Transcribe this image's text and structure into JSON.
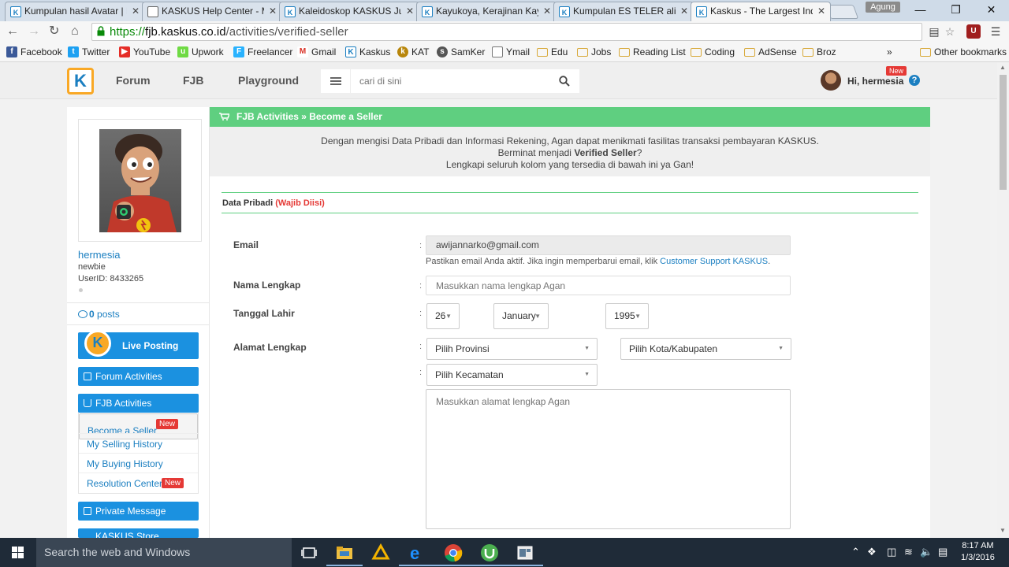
{
  "browser": {
    "tabs": [
      {
        "title": "Kumpulan hasil Avatar | K",
        "favicon": "kaskus-icon"
      },
      {
        "title": "KASKUS Help Center - M",
        "favicon": "document-icon"
      },
      {
        "title": "Kaleidoskop KASKUS Jua",
        "favicon": "kaskus-icon"
      },
      {
        "title": "Kayukoya, Kerajinan Kayu",
        "favicon": "kaskus-icon"
      },
      {
        "title": "Kumpulan ES TELER alias",
        "favicon": "kaskus-icon"
      },
      {
        "title": "Kaskus - The Largest Ind",
        "favicon": "kaskus-icon",
        "active": true
      }
    ],
    "profile_name": "Agung",
    "url_scheme": "https://",
    "url_host": "fjb.kaskus.co.id",
    "url_path": "/activities/verified-seller",
    "bookmarks": [
      {
        "label": "Facebook",
        "icon": "facebook-icon",
        "color": "#3b5998"
      },
      {
        "label": "Twitter",
        "icon": "twitter-icon",
        "color": "#1da1f2"
      },
      {
        "label": "YouTube",
        "icon": "youtube-icon",
        "color": "#e52d27"
      },
      {
        "label": "Upwork",
        "icon": "upwork-icon",
        "color": "#6fda44"
      },
      {
        "label": "Freelancer",
        "icon": "freelancer-icon",
        "color": "#29b2fe"
      },
      {
        "label": "Gmail",
        "icon": "gmail-icon",
        "color": "#d93025"
      },
      {
        "label": "Kaskus",
        "icon": "kaskus-icon",
        "color": "#1b7fc1"
      },
      {
        "label": "KAT",
        "icon": "kat-icon",
        "color": "#b8860b"
      },
      {
        "label": "SamKer",
        "icon": "samker-icon",
        "color": "#555555"
      },
      {
        "label": "Ymail",
        "icon": "document-icon",
        "color": "#888888"
      },
      {
        "label": "Edu",
        "icon": "folder-icon",
        "color": "#d8a93a"
      },
      {
        "label": "Jobs",
        "icon": "folder-icon",
        "color": "#d8a93a"
      },
      {
        "label": "Reading List",
        "icon": "folder-icon",
        "color": "#d8a93a"
      },
      {
        "label": "Coding",
        "icon": "folder-icon",
        "color": "#d8a93a"
      },
      {
        "label": "AdSense",
        "icon": "folder-icon",
        "color": "#d8a93a"
      },
      {
        "label": "Broz",
        "icon": "folder-icon",
        "color": "#d8a93a"
      }
    ],
    "more_bookmarks": "»",
    "other_bookmarks": "Other bookmarks"
  },
  "site": {
    "logo_letter": "K",
    "nav": [
      "Forum",
      "FJB",
      "Playground"
    ],
    "search_placeholder": "cari di sini",
    "greeting": "Hi, hermesia",
    "new_badge": "New",
    "help": "?"
  },
  "sidebar": {
    "username": "hermesia",
    "rank": "newbie",
    "user_id": "UserID: 8433265",
    "posts_count": "0",
    "posts_label": " posts",
    "live_posting": "Live Posting",
    "forum_activities": "Forum Activities",
    "fjb_activities": "FJB Activities",
    "fjb_items": [
      {
        "label": "Become a Seller",
        "badge": "New"
      },
      {
        "label": "My Selling History",
        "badge": ""
      },
      {
        "label": "My Buying History",
        "badge": ""
      },
      {
        "label": "Resolution Center",
        "badge": "New"
      }
    ],
    "private_message": "Private Message",
    "kaskus_store": "KASKUS Store"
  },
  "main": {
    "breadcrumb": "FJB Activities » Become a Seller",
    "intro_line1": "Dengan mengisi Data Pribadi dan Informasi Rekening, Agan dapat menikmati fasilitas transaksi pembayaran KASKUS.",
    "intro_line2_pre": "Berminat menjadi ",
    "intro_line2_bold": "Verified Seller",
    "intro_line2_post": "?",
    "intro_line3": "Lengkapi seluruh kolom yang tersedia di bawah ini ya Gan!",
    "section_title": "Data Pribadi ",
    "section_required": "(Wajib Diisi)",
    "email_label": "Email",
    "email_value": "awijannarko@gmail.com",
    "email_hint_pre": "Pastikan email Anda aktif. Jika ingin memperbarui email, klik ",
    "email_hint_link": "Customer Support KASKUS",
    "email_hint_post": ".",
    "name_label": "Nama Lengkap",
    "name_placeholder": "Masukkan nama lengkap Agan",
    "dob_label": "Tanggal Lahir",
    "dob_day": "26",
    "dob_month": "January",
    "dob_year": "1995",
    "address_label": "Alamat Lengkap",
    "province_placeholder": "Pilih Provinsi",
    "city_placeholder": "Pilih Kota/Kabupaten",
    "district_placeholder": "Pilih Kecamatan",
    "address_placeholder": "Masukkan alamat lengkap Agan",
    "colon": ":"
  },
  "taskbar": {
    "search_placeholder": "Search the web and Windows",
    "time": "8:17 AM",
    "date": "1/3/2016"
  },
  "colors": {
    "accent_green": "#5fcf80",
    "kaskus_blue": "#1b91e0",
    "badge_red": "#e53935"
  }
}
